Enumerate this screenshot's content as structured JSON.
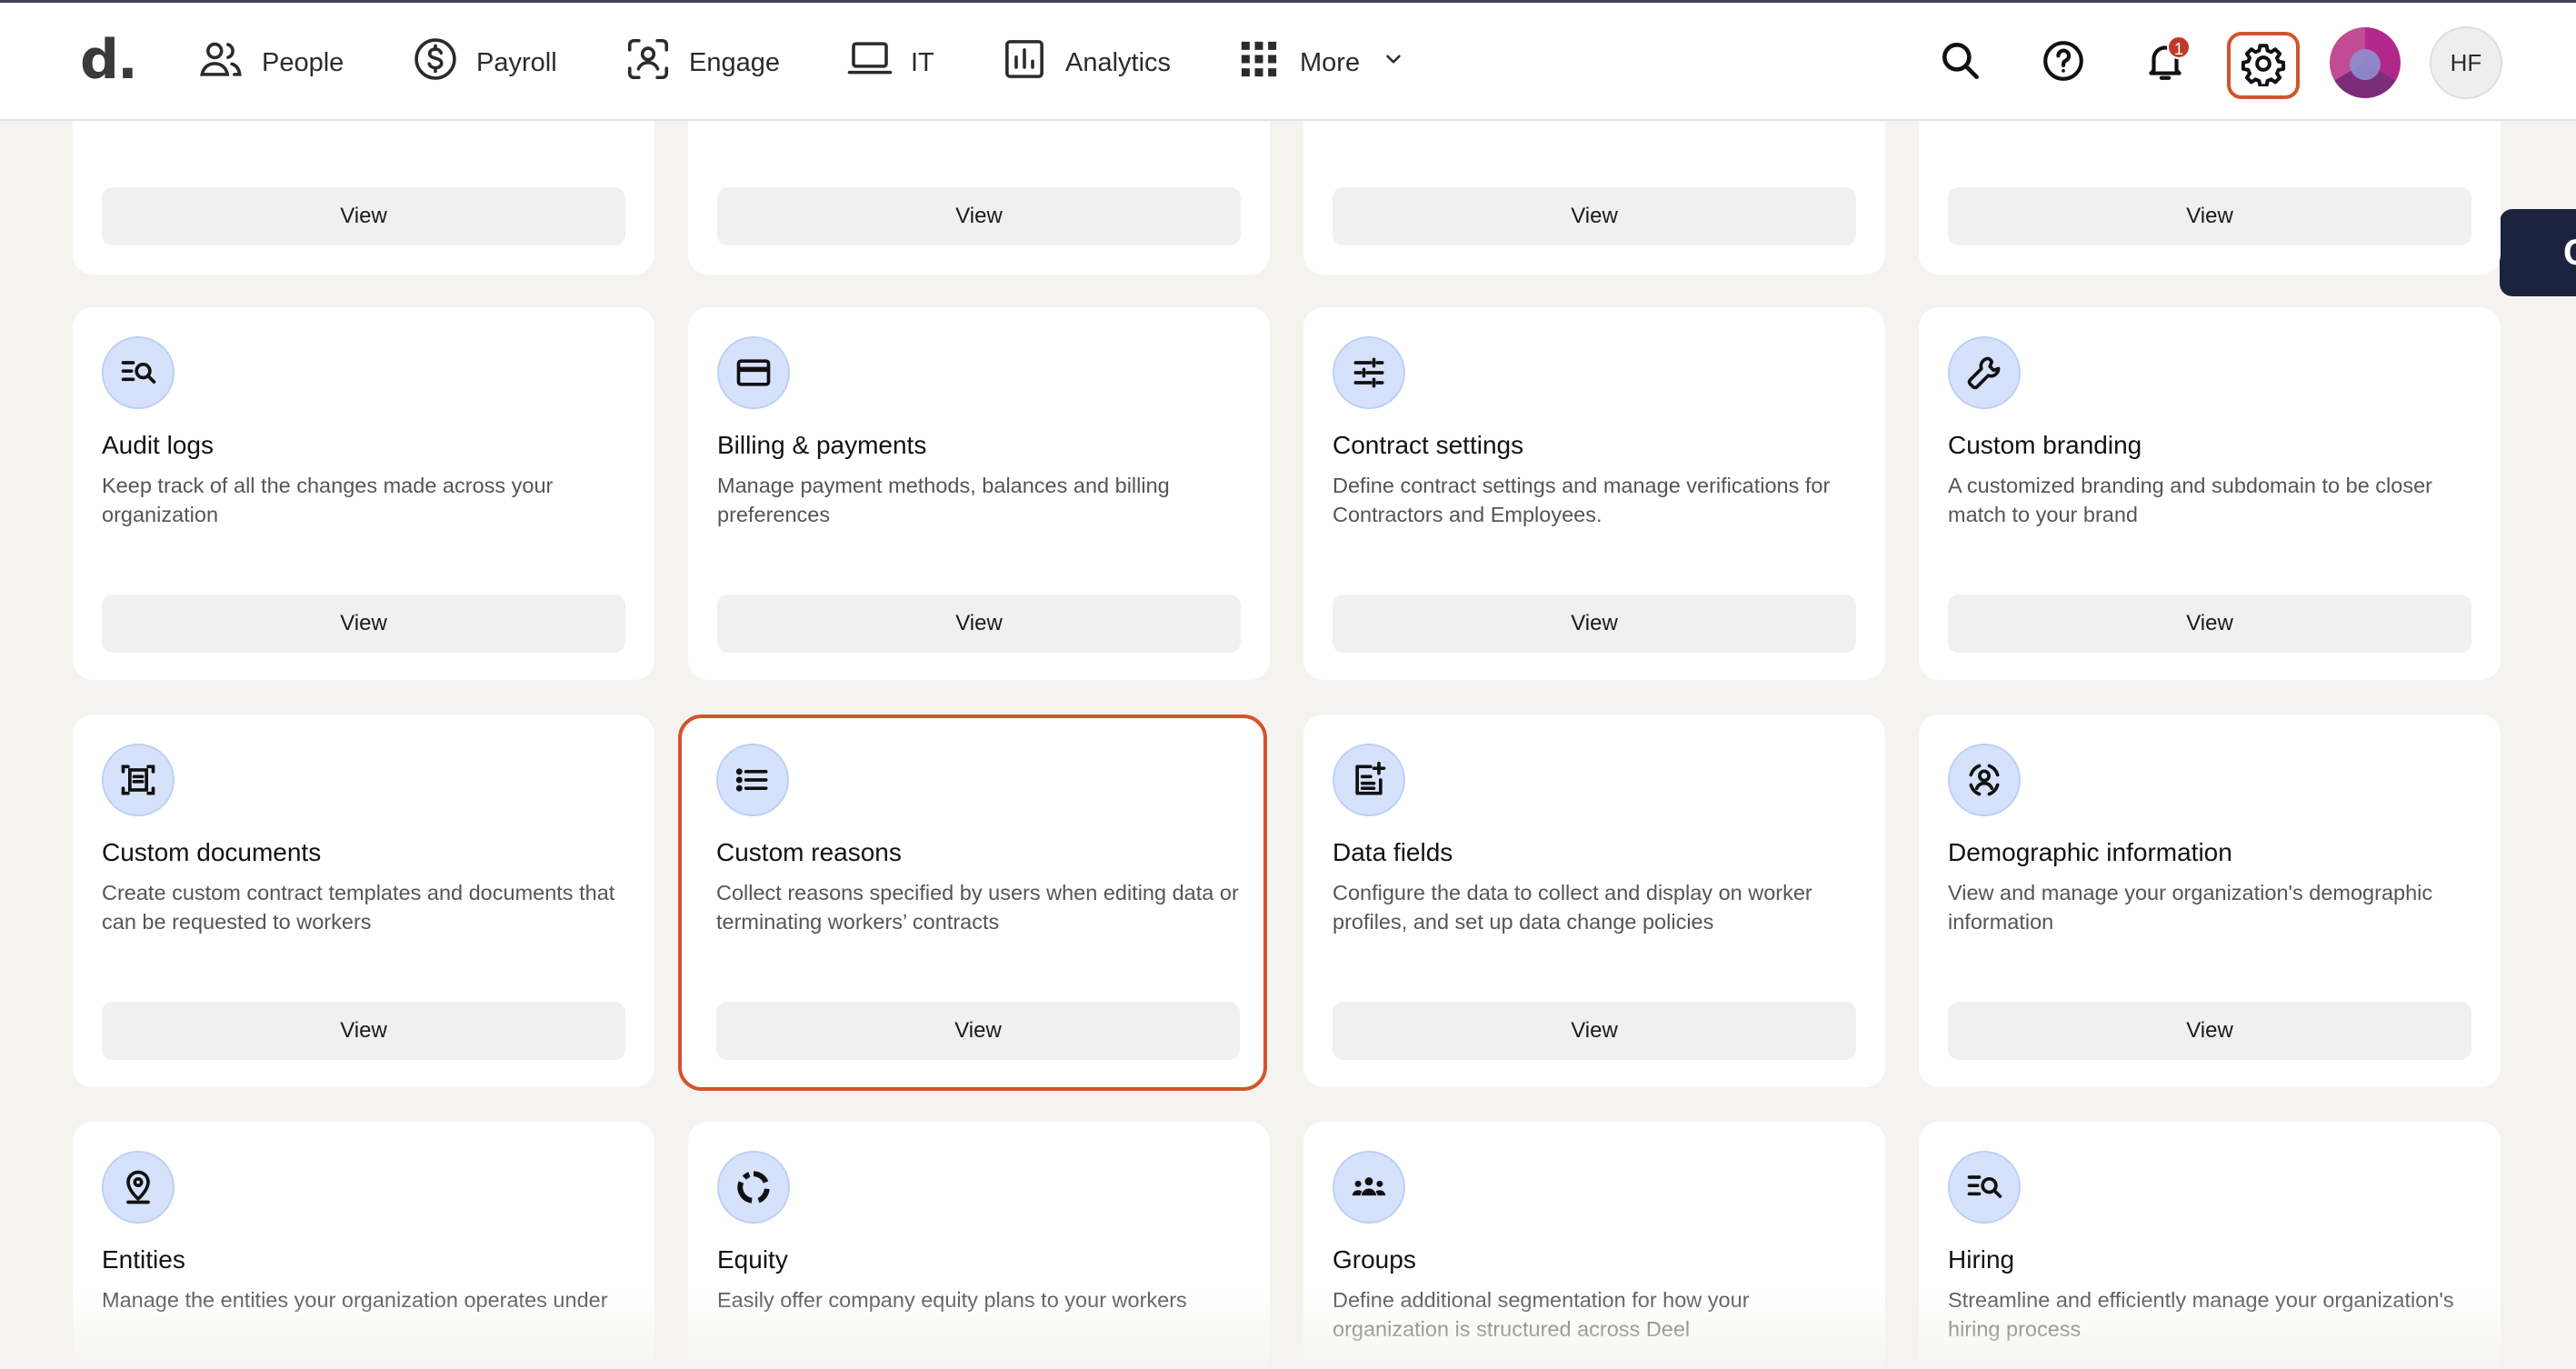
{
  "app": {
    "logo": "d."
  },
  "nav": {
    "items": [
      {
        "label": "People",
        "icon": "people-icon"
      },
      {
        "label": "Payroll",
        "icon": "dollar-icon"
      },
      {
        "label": "Engage",
        "icon": "engage-icon"
      },
      {
        "label": "IT",
        "icon": "laptop-icon"
      },
      {
        "label": "Analytics",
        "icon": "analytics-icon"
      },
      {
        "label": "More",
        "icon": "grid-icon"
      }
    ],
    "notifications_count": "1",
    "user_initials": "HF",
    "side_tab_label": "C"
  },
  "colors": {
    "accent_highlight": "#d1552c",
    "icon_circle_bg": "#d6e2fb",
    "page_bg": "#f4f3f0",
    "side_tab": "#1c2340"
  },
  "cards": {
    "row0": [
      {
        "button": "View"
      },
      {
        "button": "View"
      },
      {
        "button": "View"
      },
      {
        "button": "View"
      }
    ],
    "row1": [
      {
        "title": "Audit logs",
        "description": "Keep track of all the changes made across your organization",
        "button": "View",
        "icon": "audit-search-icon"
      },
      {
        "title": "Billing & payments",
        "description": "Manage payment methods, balances and billing preferences",
        "button": "View",
        "icon": "credit-card-icon"
      },
      {
        "title": "Contract settings",
        "description": "Define contract settings and manage verifications for Contractors and Employees.",
        "button": "View",
        "icon": "sliders-icon"
      },
      {
        "title": "Custom branding",
        "description": "A customized branding and subdomain to be closer match to your brand",
        "button": "View",
        "icon": "wrench-icon"
      }
    ],
    "row2": [
      {
        "title": "Custom documents",
        "description": "Create custom contract templates and documents that can be requested to workers",
        "button": "View",
        "icon": "document-scan-icon"
      },
      {
        "title": "Custom reasons",
        "description": "Collect reasons specified by users when editing data or terminating workers’ contracts",
        "button": "View",
        "icon": "list-icon"
      },
      {
        "title": "Data fields",
        "description": "Configure the data to collect and display on worker profiles, and set up data change policies",
        "button": "View",
        "icon": "add-note-icon"
      },
      {
        "title": "Demographic information",
        "description": "View and manage your organization's demographic information",
        "button": "View",
        "icon": "person-scan-icon"
      }
    ],
    "row3": [
      {
        "title": "Entities",
        "description": "Manage the entities your organization operates under",
        "icon": "location-pin-icon"
      },
      {
        "title": "Equity",
        "description": "Easily offer company equity plans to your workers",
        "icon": "equity-ring-icon"
      },
      {
        "title": "Groups",
        "description": "Define additional segmentation for how your organization is structured across Deel",
        "icon": "groups-icon"
      },
      {
        "title": "Hiring",
        "description": "Streamline and efficiently manage your organization's hiring process",
        "icon": "hiring-search-icon"
      }
    ]
  }
}
